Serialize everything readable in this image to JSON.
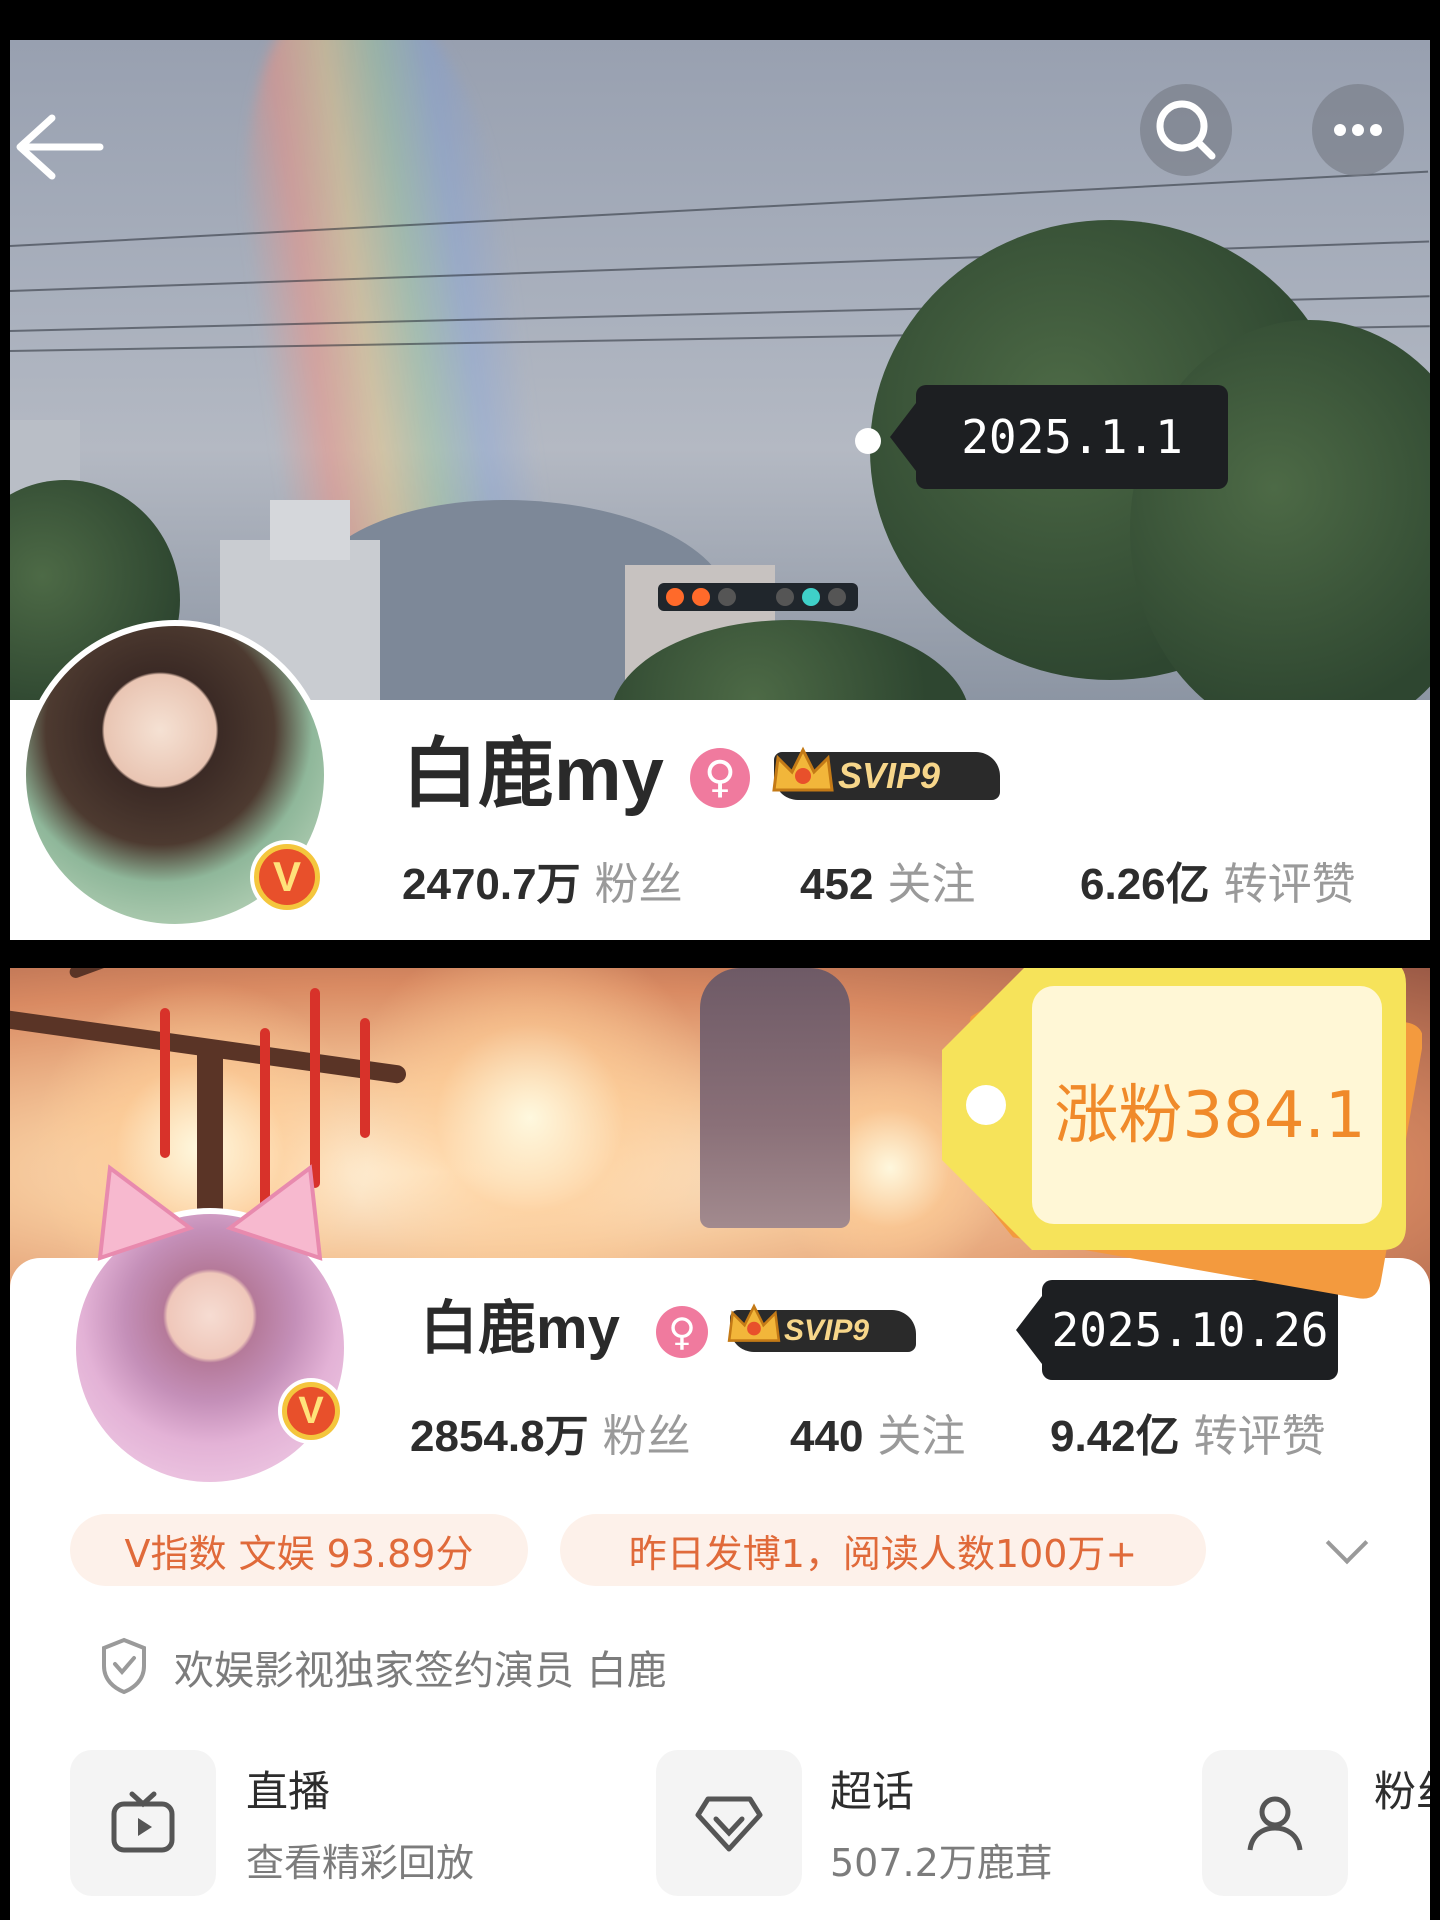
{
  "top_profile": {
    "date_tag": "2025.1.1",
    "username": "白鹿my",
    "female_symbol": "♀",
    "vip_badge": "SVIP9",
    "verified_badge": "V",
    "stats": [
      {
        "value": "2470.7万",
        "label": "粉丝"
      },
      {
        "value": "452",
        "label": "关注"
      },
      {
        "value": "6.26亿",
        "label": "转评赞"
      }
    ],
    "icons": [
      "back-arrow-icon",
      "search-icon",
      "more-icon"
    ]
  },
  "growth_tag": {
    "text": "涨粉384.1"
  },
  "bottom_profile": {
    "date_tag": "2025.10.26",
    "username": "白鹿my",
    "female_symbol": "♀",
    "vip_badge": "SVIP9",
    "verified_badge": "V",
    "stats": [
      {
        "value": "2854.8万",
        "label": "粉丝"
      },
      {
        "value": "440",
        "label": "关注"
      },
      {
        "value": "9.42亿",
        "label": "转评赞"
      }
    ],
    "pills": [
      {
        "text": "V指数 文娱 93.89分"
      },
      {
        "text": "昨日发博1，阅读人数100万+"
      }
    ],
    "certification": "欢娱影视独家签约演员 白鹿",
    "entries": [
      {
        "title": "直播",
        "subtitle": "查看精彩回放",
        "icon": "tv-play-icon"
      },
      {
        "title": "超话",
        "subtitle": "507.2万鹿茸",
        "icon": "diamond-icon"
      },
      {
        "title": "粉丝",
        "subtitle": "",
        "icon": "fans-icon"
      }
    ]
  },
  "colors": {
    "accent_orange": "#e06a3a",
    "female_pink": "#f07a9e",
    "tag_dark": "#1d1f22",
    "growth_yellow": "#f6e35a",
    "growth_orange": "#f39a3e"
  }
}
